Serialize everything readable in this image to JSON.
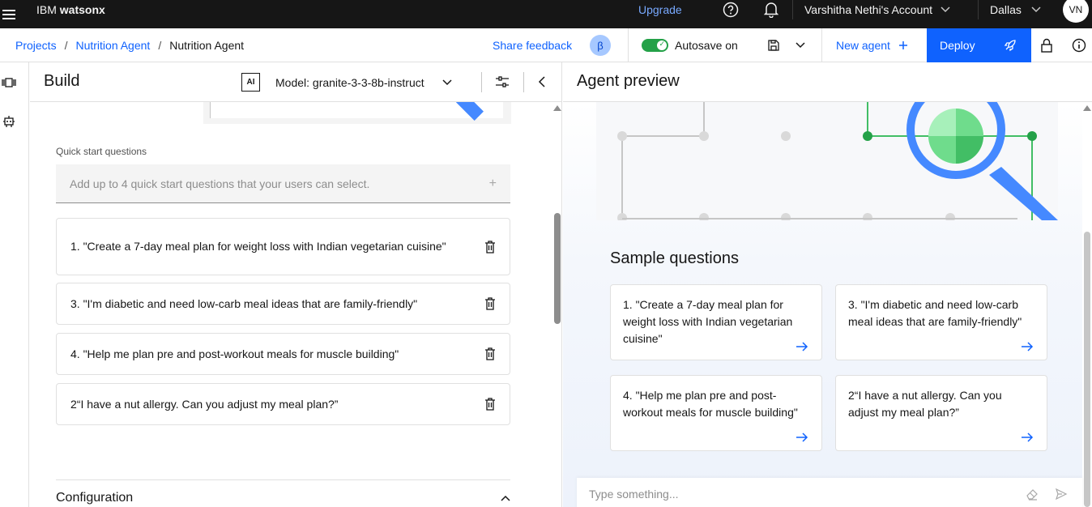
{
  "topbar": {
    "brand_prefix": "IBM",
    "brand_name": "watsonx",
    "upgrade": "Upgrade",
    "account": "Varshitha Nethi's Account",
    "region": "Dallas",
    "avatar": "VN"
  },
  "subheader": {
    "breadcrumb": [
      "Projects",
      "Nutrition Agent",
      "Nutrition Agent"
    ],
    "separator": "/",
    "share_feedback": "Share feedback",
    "beta": "β",
    "autosave": "Autosave on",
    "new_agent": "New agent",
    "deploy": "Deploy"
  },
  "build": {
    "title": "Build",
    "ai_badge": "AI",
    "model": "Model: granite-3-3-8b-instruct",
    "quick_start_label": "Quick start questions",
    "quick_start_placeholder": "Add up to 4 quick start questions that your users can select.",
    "questions": [
      "1. \"Create a 7-day meal plan for weight loss with Indian vegetarian cuisine\"",
      "3. \"I'm diabetic and need low-carb meal ideas that are family-friendly\"",
      "4. \"Help me plan pre and post-workout meals for muscle building\"",
      "2“I have a nut allergy. Can you adjust my meal plan?”"
    ],
    "configuration": "Configuration"
  },
  "preview": {
    "title": "Agent preview",
    "sample_title": "Sample questions",
    "samples": [
      "1. \"Create a 7-day meal plan for weight loss with Indian vegetarian cuisine\"",
      "3. \"I'm diabetic and need low-carb meal ideas that are family-friendly\"",
      "4. \"Help me plan pre and post-workout meals for muscle building\"",
      "2“I have a nut allergy. Can you adjust my meal plan?”"
    ],
    "input_placeholder": "Type something..."
  },
  "colors": {
    "accent": "#0f62fe",
    "topbar": "#161616",
    "toggle_on": "#24a148",
    "illustration_green": "#42be65",
    "illustration_blue": "#4589ff"
  },
  "icons": [
    "menu-icon",
    "help-icon",
    "notification-icon",
    "chevron-down-icon",
    "save-icon",
    "plus-icon",
    "rocket-icon",
    "lock-icon",
    "info-icon",
    "tune-icon",
    "chevron-left-icon",
    "trash-icon",
    "chevron-up-icon",
    "arrow-right-icon",
    "eraser-icon",
    "send-icon"
  ]
}
